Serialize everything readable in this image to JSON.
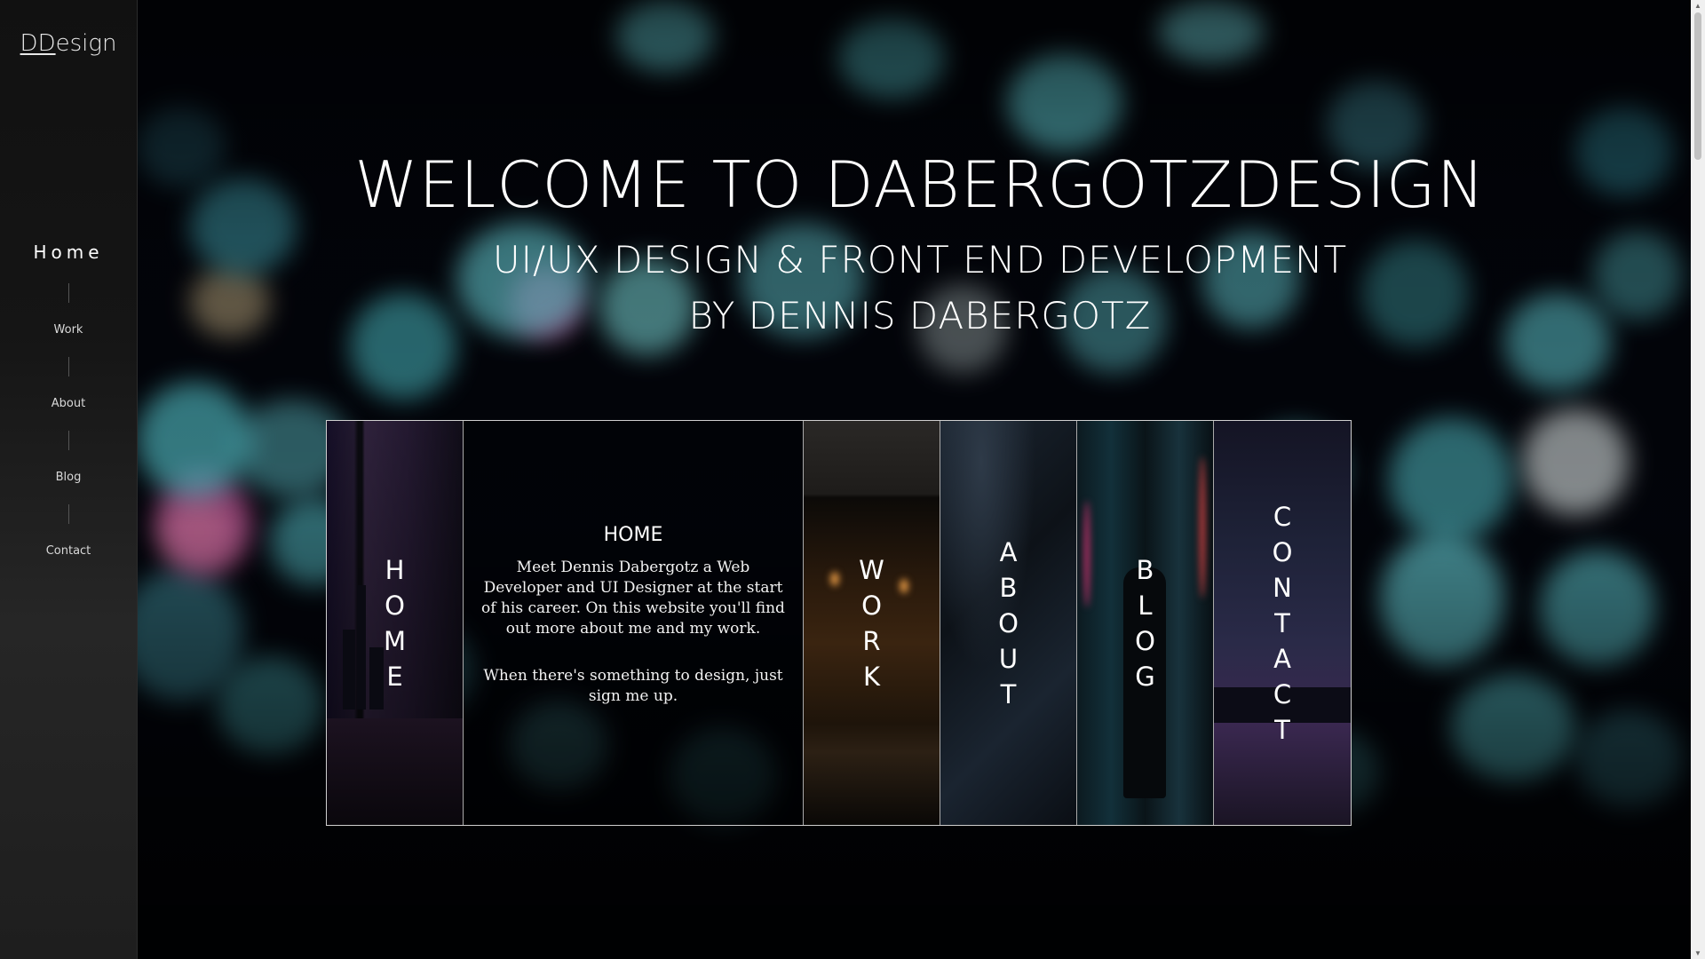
{
  "brand": {
    "logo": "DDesign",
    "logo_mark": "DD",
    "logo_rest": "esign"
  },
  "sidebar": {
    "items": [
      {
        "label": "Home",
        "active": true
      },
      {
        "label": "Work",
        "active": false
      },
      {
        "label": "About",
        "active": false
      },
      {
        "label": "Blog",
        "active": false
      },
      {
        "label": "Contact",
        "active": false
      }
    ]
  },
  "hero": {
    "title": "WELCOME TO DABERGOTZDESIGN",
    "subtitle_line1": "UI/UX DESIGN & FRONT END DEVELOPMENT",
    "subtitle_line2": "BY DENNIS DABERGOTZ"
  },
  "panels": {
    "home_letters": [
      "H",
      "O",
      "M",
      "E"
    ],
    "detail": {
      "title": "HOME",
      "text1": "Meet Dennis Dabergotz a Web Developer and UI Designer at the start of his career. On this website you'll find out more about me and my work.",
      "text2": "When there's something to design, just sign me up."
    },
    "work_letters": [
      "W",
      "O",
      "R",
      "K"
    ],
    "about_letters": [
      "A",
      "B",
      "O",
      "U",
      "T"
    ],
    "blog_letters": [
      "B",
      "L",
      "O",
      "G"
    ],
    "contact_letters": [
      "C",
      "O",
      "N",
      "T",
      "A",
      "C",
      "T"
    ]
  },
  "colors": {
    "accent": "#5fd0d8",
    "sidebar": "#1a1a1a"
  }
}
